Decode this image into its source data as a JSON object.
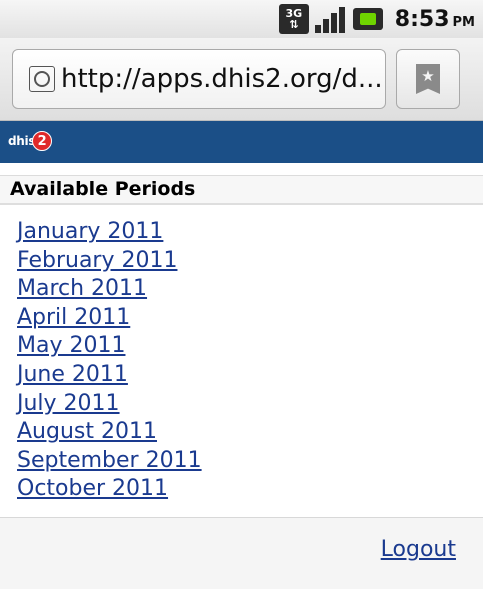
{
  "status_bar": {
    "network": "3G",
    "time": "8:53",
    "ampm": "PM"
  },
  "browser": {
    "url": "http://apps.dhis2.org/d..."
  },
  "app": {
    "logo_text": "dhis",
    "logo_badge": "2"
  },
  "section": {
    "heading": "Available Periods"
  },
  "periods": [
    "January 2011",
    "February 2011",
    "March 2011",
    "April 2011",
    "May 2011",
    "June 2011",
    "July 2011",
    "August 2011",
    "September 2011",
    "October 2011"
  ],
  "footer": {
    "logout_label": "Logout"
  },
  "colors": {
    "header_bg": "#1b4f87",
    "link": "#1a3a8f",
    "battery": "#6fd400"
  }
}
